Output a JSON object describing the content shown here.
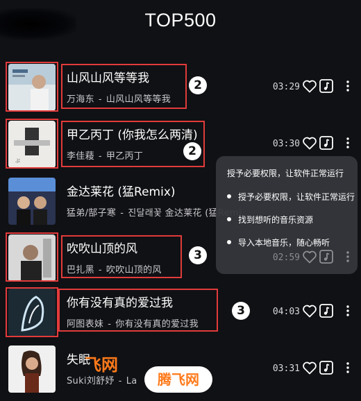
{
  "header": {
    "title": "TOP500"
  },
  "songs": [
    {
      "title": "山风山风等等我",
      "artist": "万海东",
      "album": "山风山风等等我",
      "duration": "03:29"
    },
    {
      "title": "甲乙丙丁 (你我怎么两清)",
      "artist": "李佳薐",
      "album": "甲乙丙丁",
      "duration": "03:30"
    },
    {
      "title": "金达莱花 (猛Remix)",
      "artist": "猛弟/郜子寒",
      "album": "진달래꽃 金达莱花 (猛Remi",
      "duration": ""
    },
    {
      "title": "吹吹山顶的风",
      "artist": "巴扎黑",
      "album": "吹吹山顶的风",
      "duration": "02:59"
    },
    {
      "title": "你有没有真的爱过我",
      "artist": "阿图表妹",
      "album": "你有没有真的爱过我",
      "duration": "04:03"
    },
    {
      "title": "失眠",
      "artist": "Suki刘舒妤",
      "album": "La",
      "duration": "03:31"
    }
  ],
  "annotations": [
    "2",
    "2",
    "3",
    "3"
  ],
  "tooltip": {
    "heading": "授予必要权限，让软件正常运行",
    "items": [
      "授予必要权限，让软件正常运行",
      "找到想听的音乐资源",
      "导入本地音乐，随心畅听"
    ]
  },
  "watermark": {
    "small": "飞网",
    "badge": "腾飞网"
  },
  "colors": {
    "background": "#101114",
    "annotation": "#e23b3b",
    "watermark": "#ff7a1a"
  },
  "icons": [
    "heart-icon",
    "music-note-icon",
    "more-vertical-icon"
  ]
}
